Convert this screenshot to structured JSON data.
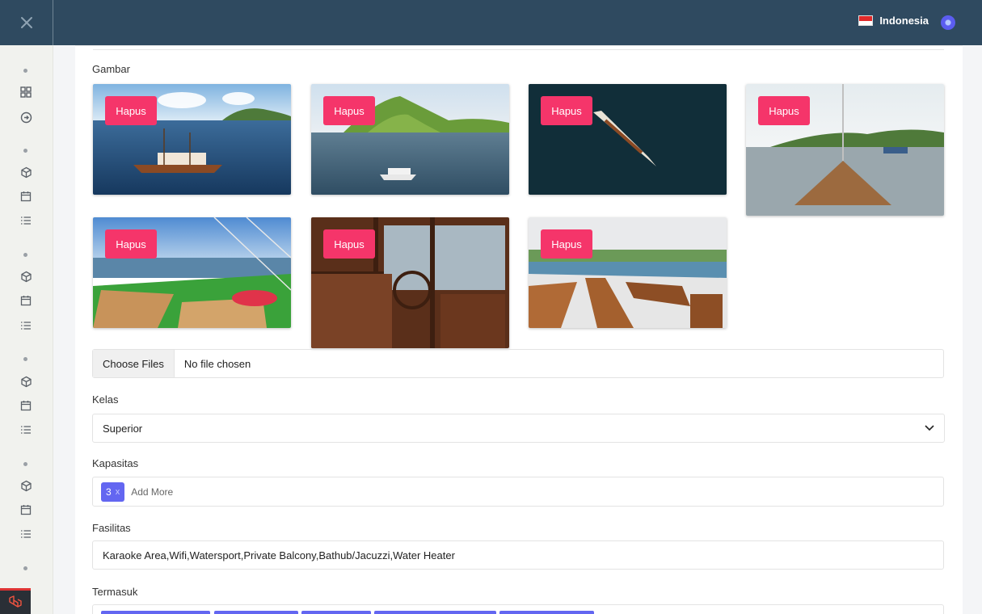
{
  "header": {
    "language": "Indonesia",
    "colors": {
      "bar": "#2f4a60",
      "accent": "#5b5df0"
    }
  },
  "sidebar": {
    "icons": [
      "dashboard-icon",
      "arrow-circle-icon",
      "cube-icon",
      "calendar-icon",
      "list-icon",
      "cube-icon",
      "calendar-icon",
      "list-icon",
      "cube-icon",
      "calendar-icon",
      "list-icon",
      "cube-icon",
      "calendar-icon",
      "list-icon"
    ]
  },
  "form": {
    "gambar_label": "Gambar",
    "delete_label": "Hapus",
    "images": [
      {
        "name": "phinisi-boat-at-sea"
      },
      {
        "name": "boat-near-green-hills"
      },
      {
        "name": "aerial-boat-dark-water"
      },
      {
        "name": "boat-bow-deck-view"
      },
      {
        "name": "sundeck-with-beanbags"
      },
      {
        "name": "wheelhouse-interior"
      },
      {
        "name": "dining-deck-tables"
      }
    ],
    "file": {
      "button": "Choose Files",
      "status": "No file chosen"
    },
    "kelas": {
      "label": "Kelas",
      "value": "Superior"
    },
    "kapasitas": {
      "label": "Kapasitas",
      "tag": "3",
      "tag_remove": "x",
      "placeholder": "Add More"
    },
    "fasilitas": {
      "label": "Fasilitas",
      "value": "Karaoke Area,Wifi,Watersport,Private Balcony,Bathub/Jacuzzi,Water Heater"
    },
    "termasuk": {
      "label": "Termasuk"
    },
    "colors": {
      "delete_button": "#f5356a",
      "tag": "#6366f1"
    }
  }
}
